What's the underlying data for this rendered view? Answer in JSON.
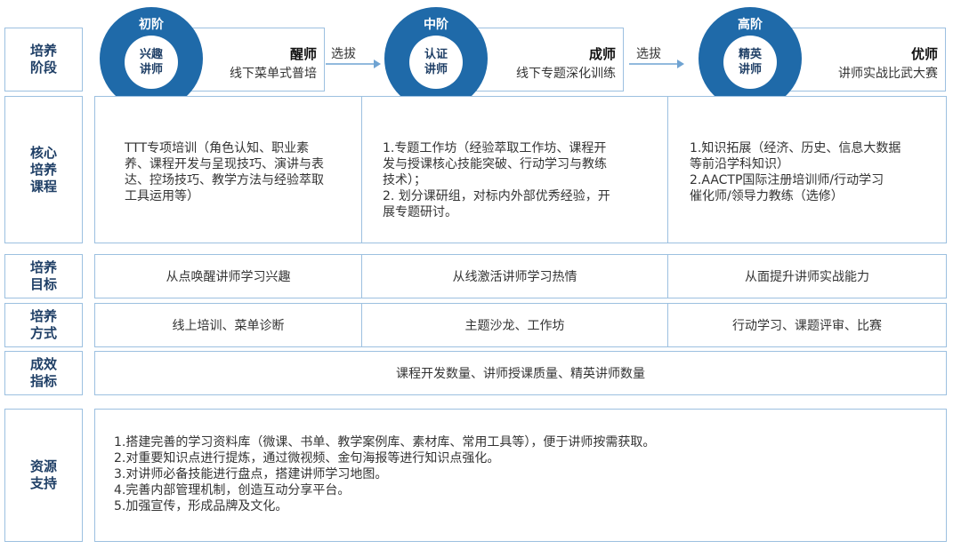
{
  "labels": {
    "stage": "培养\n阶段",
    "course": "核心\n培养\n课程",
    "goal": "培养\n目标",
    "method": "培养\n方式",
    "metrics": "成效\n指标",
    "support": "资源\n支持"
  },
  "stages": [
    {
      "level": "初阶",
      "circle": "兴趣\n讲师",
      "title": "醒师",
      "subtitle": "线下菜单式普培"
    },
    {
      "level": "中阶",
      "circle": "认证\n讲师",
      "title": "成师",
      "subtitle": "线下专题深化训练"
    },
    {
      "level": "高阶",
      "circle": "精英\n讲师",
      "title": "优师",
      "subtitle": "讲师实战比武大赛"
    }
  ],
  "arrows": [
    "选拔",
    "选拔"
  ],
  "courses": [
    "TTT专项培训（角色认知、职业素\n养、课程开发与呈现技巧、演讲与表\n达、控场技巧、教学方法与经验萃取\n工具运用等）",
    "1.专题工作坊（经验萃取工作坊、课程开\n发与授课核心技能突破、行动学习与教练\n技术）；\n2. 划分课研组，对标内外部优秀经验，开\n展专题研讨。",
    "1.知识拓展（经济、历史、信息大数据\n等前沿学科知识）\n2.AACTP国际注册培训师/行动学习\n催化师/领导力教练（选修）"
  ],
  "goals": [
    "从点唤醒讲师学习兴趣",
    "从线激活讲师学习热情",
    "从面提升讲师实战能力"
  ],
  "methods": [
    "线上培训、菜单诊断",
    "主题沙龙、工作坊",
    "行动学习、课题评审、比赛"
  ],
  "metrics": "课程开发数量、讲师授课质量、精英讲师数量",
  "support": "1.搭建完善的学习资料库（微课、书单、教学案例库、素材库、常用工具等），便于讲师按需获取。\n2.对重要知识点进行提炼，通过微视频、金句海报等进行知识点强化。\n3.对讲师必备技能进行盘点，搭建讲师学习地图。\n4.完善内部管理机制，创造互动分享平台。\n5.加强宣传，形成品牌及文化。",
  "colors": {
    "circle": "#1f6aa9",
    "border": "#9cc0e0",
    "label_text": "#1f3f66"
  }
}
